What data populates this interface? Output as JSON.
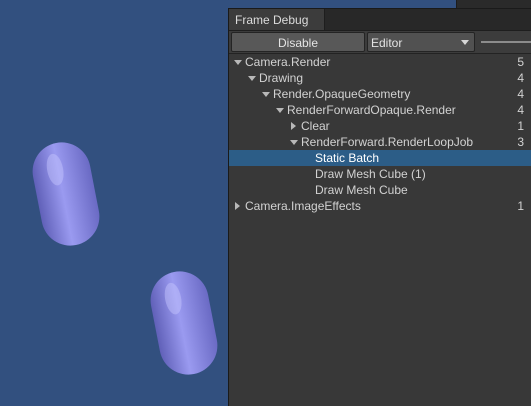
{
  "scene": {
    "background_color": "#32507f",
    "capsule_color": "#8e8ee0"
  },
  "frame_debug": {
    "tab_label": "Frame Debug",
    "disable_label": "Disable",
    "target_dropdown_value": "Editor",
    "tree": [
      {
        "label": "Camera.Render",
        "count": "5",
        "expand": "open",
        "selected": false
      },
      {
        "label": "Drawing",
        "count": "4",
        "expand": "open",
        "selected": false
      },
      {
        "label": "Render.OpaqueGeometry",
        "count": "4",
        "expand": "open",
        "selected": false
      },
      {
        "label": "RenderForwardOpaque.Render",
        "count": "4",
        "expand": "open",
        "selected": false
      },
      {
        "label": "Clear",
        "count": "1",
        "expand": "closed",
        "selected": false
      },
      {
        "label": "RenderForward.RenderLoopJob",
        "count": "3",
        "expand": "open",
        "selected": false
      },
      {
        "label": "Static Batch",
        "count": "",
        "expand": "none",
        "selected": true
      },
      {
        "label": "Draw Mesh Cube (1)",
        "count": "",
        "expand": "none",
        "selected": false
      },
      {
        "label": "Draw Mesh Cube",
        "count": "",
        "expand": "none",
        "selected": false
      },
      {
        "label": "Camera.ImageEffects",
        "count": "1",
        "expand": "closed",
        "selected": false
      }
    ]
  }
}
